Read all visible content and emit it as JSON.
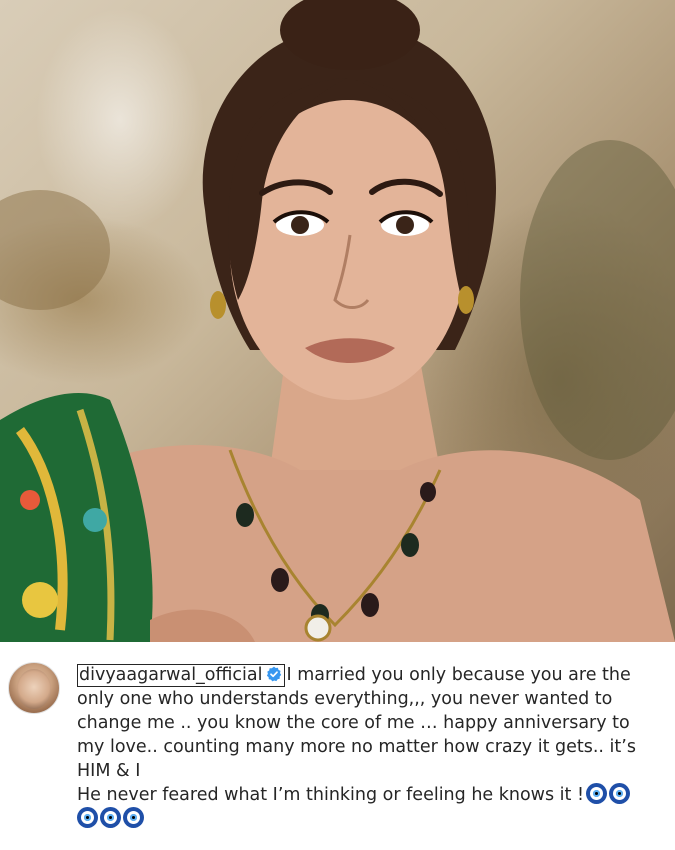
{
  "post": {
    "image": {
      "icon": "portrait-photo",
      "description_icon": "photo"
    },
    "author": {
      "username": "divyaagarwal_official",
      "verified": true,
      "avatar_icon": "profile-avatar"
    },
    "caption": {
      "line1": "I married you only because you are the",
      "line2": "only one who understands everything,,, you never wanted to",
      "line3": "change me .. you know the core of me … happy anniversary to",
      "line4": "my love.. counting many more no matter how crazy it gets.. it’s",
      "line5": "HIM & I",
      "line6": "He never feared what I’m thinking or feeling he knows it !",
      "emoji_name": "nazar-amulet",
      "emoji_count_line6": 2,
      "emoji_count_line7": 3
    },
    "colors": {
      "text": "#262626",
      "verified": "#3797f0",
      "evil_eye_blue": "#1f4fa8"
    }
  }
}
